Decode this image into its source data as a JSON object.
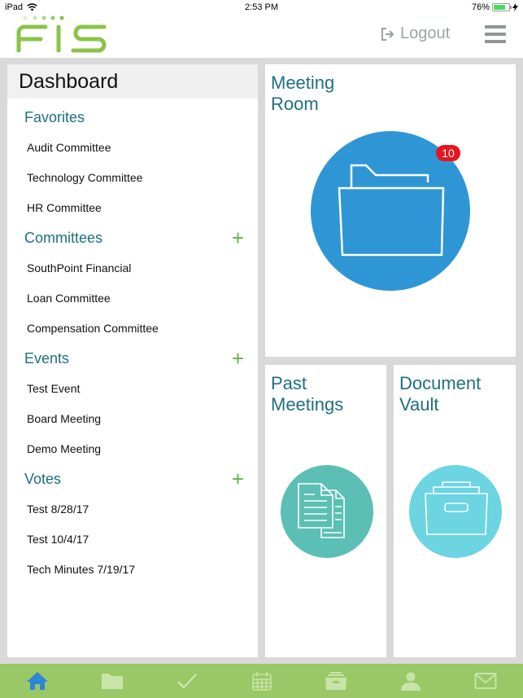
{
  "status_bar": {
    "device": "iPad",
    "time": "2:53 PM",
    "battery_percent_label": "76%",
    "battery_level": 0.76
  },
  "header": {
    "logo_text": "FIS",
    "logout_label": "Logout",
    "logout_icon": "logout-icon",
    "menu_icon": "hamburger-menu-icon"
  },
  "colors": {
    "brand_green": "#8bc34a",
    "heading_teal": "#1e6f80",
    "plus_green": "#6ab04c",
    "meeting_room_blue": "#2f96d5",
    "past_meetings_teal": "#5bbfb5",
    "doc_vault_cyan": "#6dd4e1",
    "badge_red": "#e8151e",
    "tabbar_green": "#9ac866",
    "active_tab_blue": "#2f86d6"
  },
  "sidebar": {
    "title": "Dashboard",
    "sections": [
      {
        "heading": "Favorites",
        "has_add": false,
        "items": [
          "Audit Committee",
          "Technology Committee",
          "HR Committee"
        ]
      },
      {
        "heading": "Committees",
        "has_add": true,
        "add_label": "+",
        "items": [
          "SouthPoint Financial",
          "Loan Committee",
          "Compensation Committee"
        ]
      },
      {
        "heading": "Events",
        "has_add": true,
        "add_label": "+",
        "items": [
          "Test Event",
          "Board Meeting",
          "Demo Meeting"
        ]
      },
      {
        "heading": "Votes",
        "has_add": true,
        "add_label": "+",
        "items": [
          "Test 8/28/17",
          "Test 10/4/17",
          "Tech Minutes 7/19/17"
        ]
      }
    ]
  },
  "tiles": {
    "meeting_room": {
      "title_line1": "Meeting",
      "title_line2": "Room",
      "icon": "folder-icon",
      "badge": "10"
    },
    "past_meetings": {
      "title_line1": "Past",
      "title_line2": "Meetings",
      "icon": "documents-icon"
    },
    "document_vault": {
      "title_line1": "Document",
      "title_line2": "Vault",
      "icon": "file-box-icon"
    }
  },
  "tabbar": {
    "tabs": [
      {
        "icon": "home-icon",
        "active": true
      },
      {
        "icon": "folder-icon",
        "active": false
      },
      {
        "icon": "checkmark-icon",
        "active": false
      },
      {
        "icon": "calendar-icon",
        "active": false
      },
      {
        "icon": "file-box-icon",
        "active": false
      },
      {
        "icon": "user-icon",
        "active": false
      },
      {
        "icon": "mail-icon",
        "active": false
      }
    ]
  }
}
